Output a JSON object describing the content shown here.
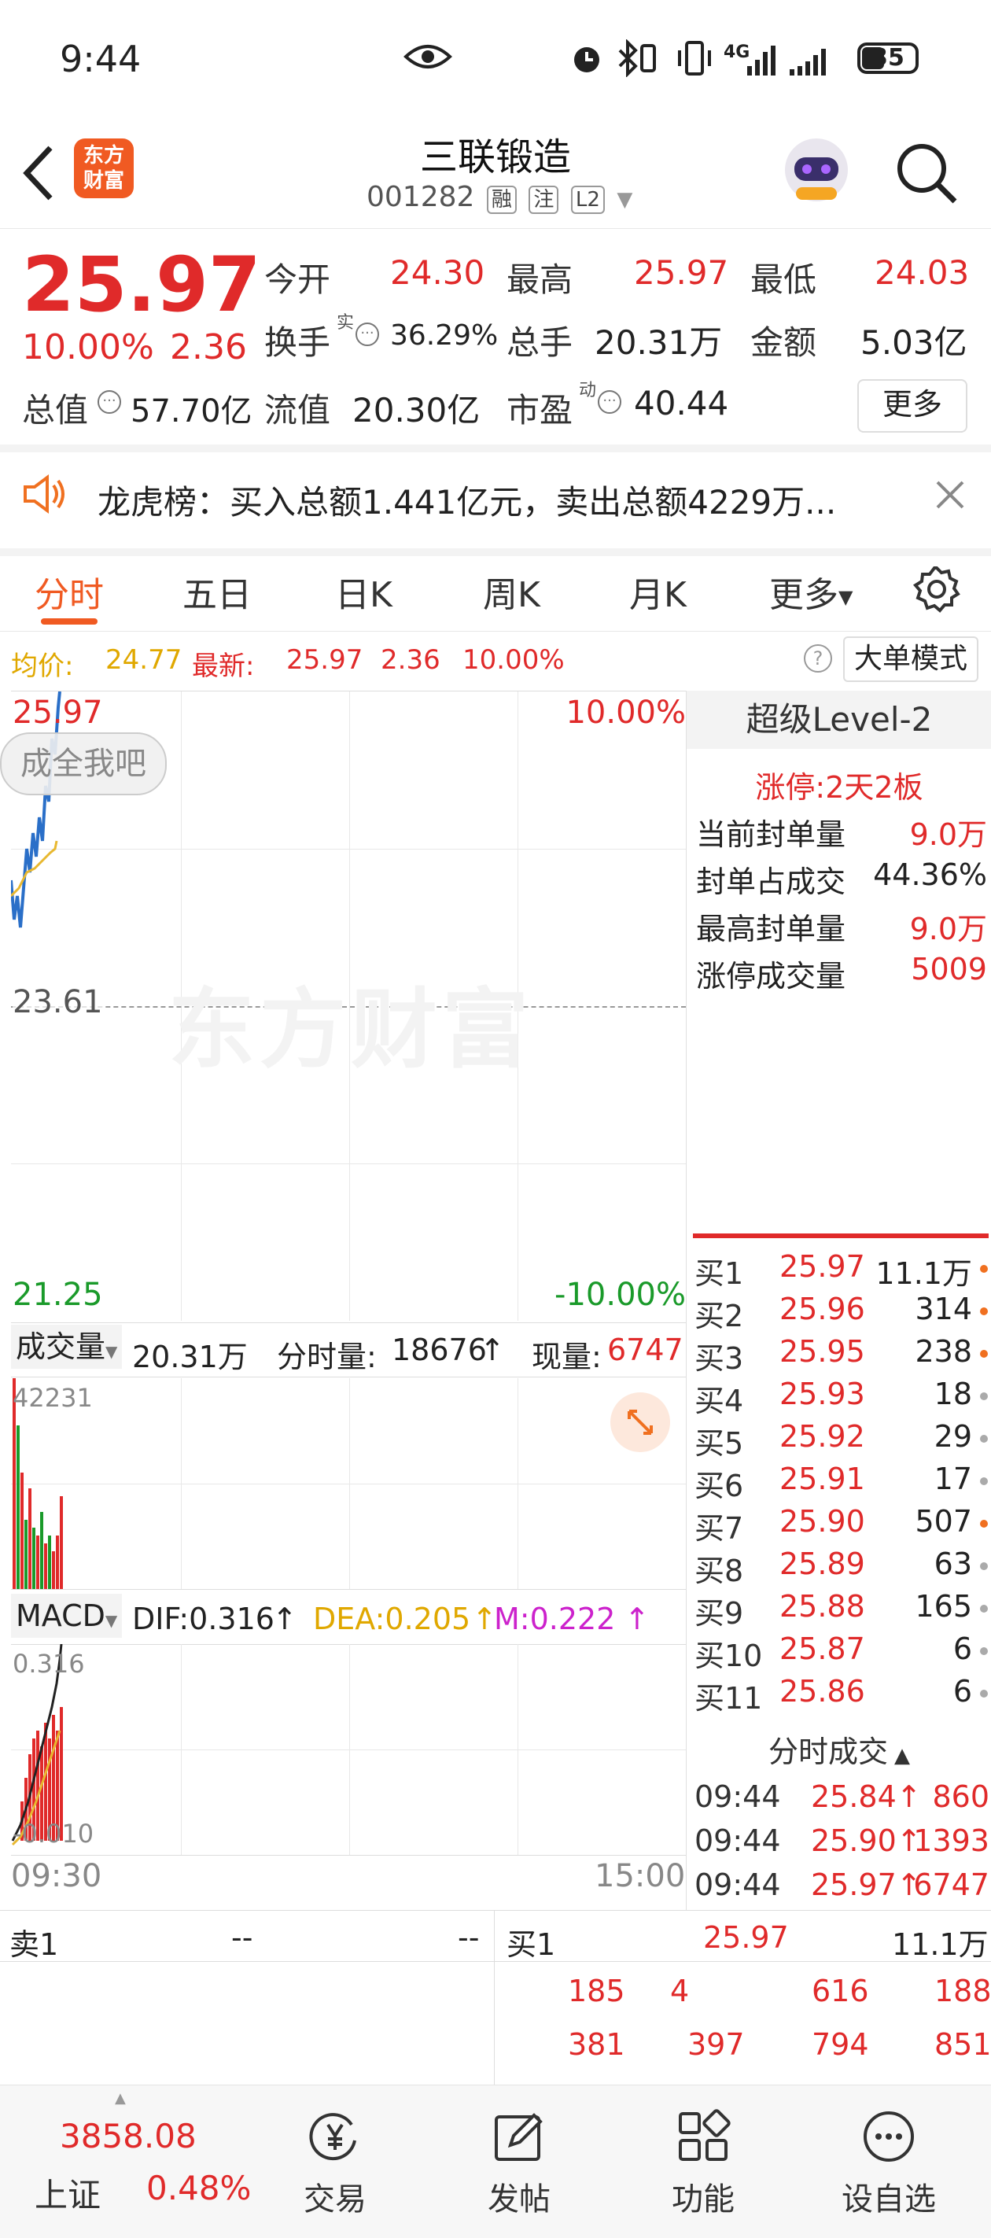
{
  "status_bar": {
    "time": "9:44",
    "battery": "35",
    "network": "4G"
  },
  "header": {
    "logo_line1": "东方",
    "logo_line2": "财富",
    "title": "三联锻造",
    "code": "001282",
    "tags": [
      "融",
      "注",
      "L2"
    ]
  },
  "quote": {
    "price": "25.97",
    "change_pct": "10.00%",
    "change": "2.36",
    "open_label": "今开",
    "open": "24.30",
    "high_label": "最高",
    "high": "25.97",
    "low_label": "最低",
    "low": "24.03",
    "turnover_label": "换手",
    "turnover_sup": "实",
    "turnover": "36.29%",
    "volume_label": "总手",
    "volume": "20.31万",
    "amount_label": "金额",
    "amount": "5.03亿",
    "mktcap_label": "总值",
    "mktcap": "57.70亿",
    "float_label": "流值",
    "float": "20.30亿",
    "pe_label": "市盈",
    "pe_sup": "动",
    "pe": "40.44",
    "more_label": "更多"
  },
  "notice": {
    "text": "龙虎榜：买入总额1.441亿元，卖出总额4229万..."
  },
  "tabs": [
    "分时",
    "五日",
    "日K",
    "周K",
    "月K",
    "更多"
  ],
  "avg_line": {
    "avg_label": "均价:",
    "avg": "24.77",
    "latest_label": "最新:",
    "latest": "25.97",
    "chg": "2.36",
    "pct": "10.00%",
    "bigorder": "大单模式"
  },
  "chart": {
    "top_price": "25.97",
    "top_pct": "10.00%",
    "mid_price": "23.61",
    "bottom_price": "21.25",
    "bottom_pct": "-10.00%",
    "watermark": "东方财富",
    "bubble": "成全我吧",
    "vol_label": "成交量",
    "vol_total": "20.31万",
    "vol_fs_label": "分时量:",
    "vol_fs": "18676",
    "vol_now_label": "现量:",
    "vol_now": "6747",
    "vol_max": "42231",
    "macd_label": "MACD",
    "dif": "DIF:0.316",
    "dea": "DEA:0.205",
    "m": "M:0.222",
    "macd_top": "0.316",
    "macd_bottom": "-0.010",
    "time_start": "09:30",
    "time_end": "15:00"
  },
  "level2": {
    "title": "超级Level-2",
    "limit_label": "涨停:",
    "limit_val": "2天2板",
    "rows": [
      {
        "label": "当前封单量",
        "value": "9.0万"
      },
      {
        "label": "封单占成交",
        "value": "44.36%"
      },
      {
        "label": "最高封单量",
        "value": "9.0万"
      },
      {
        "label": "涨停成交量",
        "value": "5009"
      }
    ],
    "bids": [
      {
        "label": "买1",
        "price": "25.97",
        "vol": "11.1万",
        "dot": "#f07020"
      },
      {
        "label": "买2",
        "price": "25.96",
        "vol": "314",
        "dot": "#f07020"
      },
      {
        "label": "买3",
        "price": "25.95",
        "vol": "238",
        "dot": "#f07020"
      },
      {
        "label": "买4",
        "price": "25.93",
        "vol": "18",
        "dot": "#aaaaaa"
      },
      {
        "label": "买5",
        "price": "25.92",
        "vol": "29",
        "dot": "#aaaaaa"
      },
      {
        "label": "买6",
        "price": "25.91",
        "vol": "17",
        "dot": "#aaaaaa"
      },
      {
        "label": "买7",
        "price": "25.90",
        "vol": "507",
        "dot": "#f07020"
      },
      {
        "label": "买8",
        "price": "25.89",
        "vol": "63",
        "dot": "#aaaaaa"
      },
      {
        "label": "买9",
        "price": "25.88",
        "vol": "165",
        "dot": "#aaaaaa"
      },
      {
        "label": "买10",
        "price": "25.87",
        "vol": "6",
        "dot": "#aaaaaa"
      },
      {
        "label": "买11",
        "price": "25.86",
        "vol": "6",
        "dot": "#aaaaaa"
      }
    ],
    "ticks_title": "分时成交",
    "ticks": [
      {
        "time": "09:44",
        "price": "25.84↑",
        "vol": "860"
      },
      {
        "time": "09:44",
        "price": "25.90↑",
        "vol": "1393"
      },
      {
        "time": "09:44",
        "price": "25.97↑",
        "vol": "6747"
      }
    ]
  },
  "queue": {
    "sell_label": "卖1",
    "sell_price": "--",
    "sell_vol": "--",
    "buy_label": "买1",
    "buy_price": "25.97",
    "buy_vol": "11.1万",
    "row1": [
      "185",
      "4",
      "616",
      "188"
    ],
    "row2": [
      "381",
      "397",
      "794",
      "851"
    ]
  },
  "nav": {
    "index_value": "3858.08",
    "index_name": "上证",
    "index_pct": "0.48%",
    "items": [
      "交易",
      "发帖",
      "功能",
      "设自选"
    ]
  }
}
